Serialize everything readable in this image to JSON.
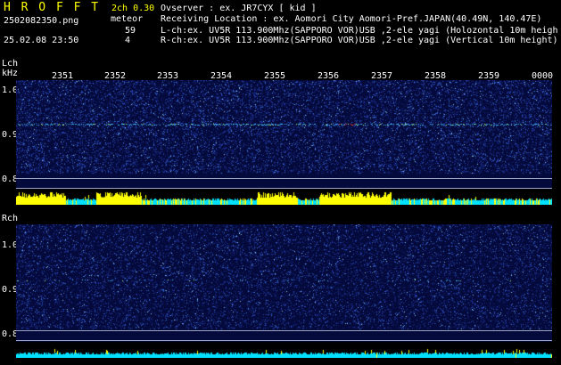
{
  "header": {
    "brand": "H R O F F T",
    "version": "2ch 0.30",
    "filename": "2502082350.png",
    "meteor_label": "meteor",
    "count_l": "59",
    "count_r": "4",
    "datetime": "25.02.08 23:50",
    "observer_line": "Ovserver           : ex. JR7CYX [ kid ]",
    "location_line": "Receiving Location : ex. Aomori City Aomori-Pref.JAPAN(40.49N, 140.47E)",
    "lch_line": "L-ch:ex. UV5R 113.900Mhz(SAPPORO VOR)USB ,2-ele yagi (Holozontal 10m height)",
    "rch_line": "R-ch:ex. UV5R 113.900Mhz(SAPPORO VOR)USB ,2-ele yagi (Vertical 10m height)"
  },
  "time_labels": [
    "2351",
    "2352",
    "2353",
    "2354",
    "2355",
    "2356",
    "2357",
    "2358",
    "2359",
    "0000"
  ],
  "lch": {
    "title": "Lch",
    "unit": "kHz",
    "ticks": [
      "1.0",
      "0.9",
      "0.8"
    ]
  },
  "rch": {
    "title": "Rch",
    "ticks": [
      "1.0",
      "0.9",
      "0.8"
    ]
  },
  "colors": {
    "background": "#000000",
    "spectrum_bg": "#050a3c",
    "signal_line": "#40c0ff",
    "level_bar": "#00e0ff",
    "meteor_bar": "#ffff00",
    "text": "#ffffff",
    "brand": "#ffff00"
  }
}
